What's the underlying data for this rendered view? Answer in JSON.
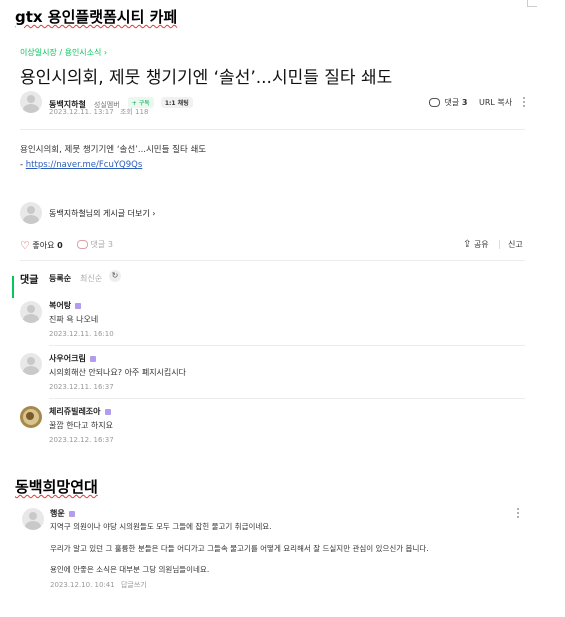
{
  "page_heading": "gtx 용인플랫폼시티 카페",
  "article": {
    "breadcrumb": "이상일시장 / 용인시소식",
    "title": "용인시의회, 제뭇 챙기기엔 ‘솔선’...시민들 질타 쇄도",
    "author": {
      "name": "동백지하철",
      "grade": "성실멤버",
      "follow_label": "+ 구독",
      "chat_label": "1:1 채팅",
      "date": "2023.12.11. 13:17",
      "views": "조회 118"
    },
    "comment_count_label": "댓글",
    "comment_count": "3",
    "url_copy": "URL 복사",
    "body_line": "용인시의회, 제뭇 챙기기엔 ‘솔선’...시민들 질타 쇄도",
    "link_prefix": "- ",
    "link": "https://naver.me/FcuYQ9Qs",
    "more_posts": "동백지하철님의 게시글 더보기",
    "likes_label": "좋아요",
    "likes_count": "0",
    "comments_action": "댓글",
    "comments_action_count": "3",
    "share": "공유",
    "report": "신고"
  },
  "comments_section": {
    "title": "댓글",
    "sort_register": "등록순",
    "sort_latest": "최신순",
    "refresh_icon": "refresh-icon",
    "items": [
      {
        "author": "복어탕",
        "text": "진짜 욕 나오네",
        "date": "2023.12.11. 16:10"
      },
      {
        "author": "사우어크림",
        "text": "시의회해산 안되나요? 아주 폐지시킵시다",
        "date": "2023.12.11. 16:37"
      },
      {
        "author": "체리쥬빌레조아",
        "text": "꿀깝 한다고 하지요",
        "date": "2023.12.12. 16:37"
      }
    ]
  },
  "second_heading": "동백희망연대",
  "second_comment": {
    "author": "행운",
    "line1": "지역구 의원이나 야당 시의원들도 모두 그들에 잡힌 물고기 취급이네요.",
    "line2": "우리가 알고 있던 그 훌륭한 분들은 다들 어디가고 그들속 물고기를 어떻게 요리해서 잘 드실지만 관심이 있으신가 봅니다.",
    "line3": "용인에 안좋은 소식은 대부분 그당 의원님들이네요.",
    "date": "2023.12.10. 10:41",
    "reply": "답글쓰기"
  },
  "colors": {
    "accent_green": "#03c75a",
    "link_blue": "#2b5db8",
    "heart_red": "#e0353f",
    "badge_purple": "#b39cf0"
  }
}
